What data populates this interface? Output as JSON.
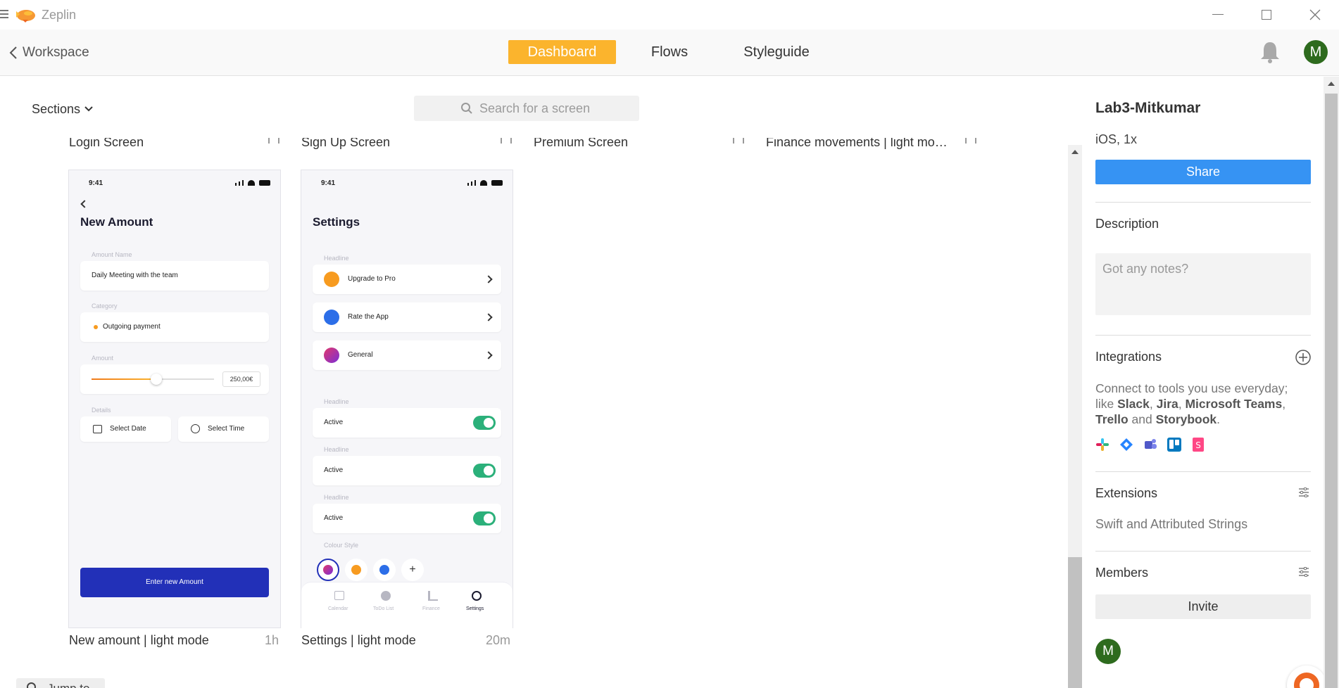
{
  "window": {
    "app_name": "Zeplin",
    "menu_icon": "hamburger-icon",
    "logo_icon": "zeplin-blimp-icon"
  },
  "nav": {
    "back_label": "Workspace",
    "tabs": [
      {
        "label": "Dashboard",
        "active": true
      },
      {
        "label": "Flows",
        "active": false
      },
      {
        "label": "Styleguide",
        "active": false
      }
    ],
    "avatar_initial": "M"
  },
  "toolbar": {
    "sections_label": "Sections",
    "search_placeholder": "Search for a screen"
  },
  "screens": [
    {
      "name": "Login Screen",
      "time": ""
    },
    {
      "name": "Sign Up Screen",
      "time": ""
    },
    {
      "name": "Premium Screen",
      "time": ""
    },
    {
      "name": "Finance movements | light mo…",
      "time": ""
    },
    {
      "name": "New amount | light mode",
      "time": "1h"
    },
    {
      "name": "Settings | light mode",
      "time": "20m"
    }
  ],
  "phone_amount": {
    "time": "9:41",
    "title": "New Amount",
    "amount_name_label": "Amount Name",
    "amount_name_value": "Daily Meeting with the team",
    "category_label": "Category",
    "category_value": "Outgoing payment",
    "amount_label": "Amount",
    "amount_value": "250,00€",
    "slider_fraction": 0.53,
    "details_label": "Details",
    "select_date": "Select Date",
    "select_time": "Select Time",
    "button": "Enter new Amount"
  },
  "phone_settings": {
    "time": "9:41",
    "title": "Settings",
    "headline": "Headline",
    "rows": [
      "Upgrade to Pro",
      "Rate the App",
      "General"
    ],
    "toggle_label": "Active",
    "colour_style_label": "Colour Style",
    "tabs": [
      "Calendar",
      "ToDo List",
      "Finance",
      "Settings"
    ]
  },
  "sidebar": {
    "project_name": "Lab3-Mitkumar",
    "platform": "iOS, 1x",
    "share": "Share",
    "description_title": "Description",
    "description_placeholder": "Got any notes?",
    "integrations_title": "Integrations",
    "integrations_text_1": "Connect to tools you use everyday;",
    "integrations_text_2a": "like ",
    "integrations_slack": "Slack",
    "integrations_sep1": ", ",
    "integrations_jira": "Jira",
    "integrations_sep2": ", ",
    "integrations_teams": "Microsoft Teams",
    "integrations_sep3": ",",
    "integrations_trello": "Trello",
    "integrations_and": " and ",
    "integrations_storybook": "Storybook",
    "integrations_dot": ".",
    "extensions_title": "Extensions",
    "extensions_text": "Swift and Attributed Strings",
    "members_title": "Members",
    "invite": "Invite",
    "member_initial": "M"
  },
  "footer": {
    "jump_to": "Jump to"
  },
  "colors": {
    "accent": "#fbb42d",
    "share": "#3693f3",
    "avatar": "#2e6b1e",
    "primary_button": "#2230b8",
    "toggle": "#2bb07a"
  }
}
